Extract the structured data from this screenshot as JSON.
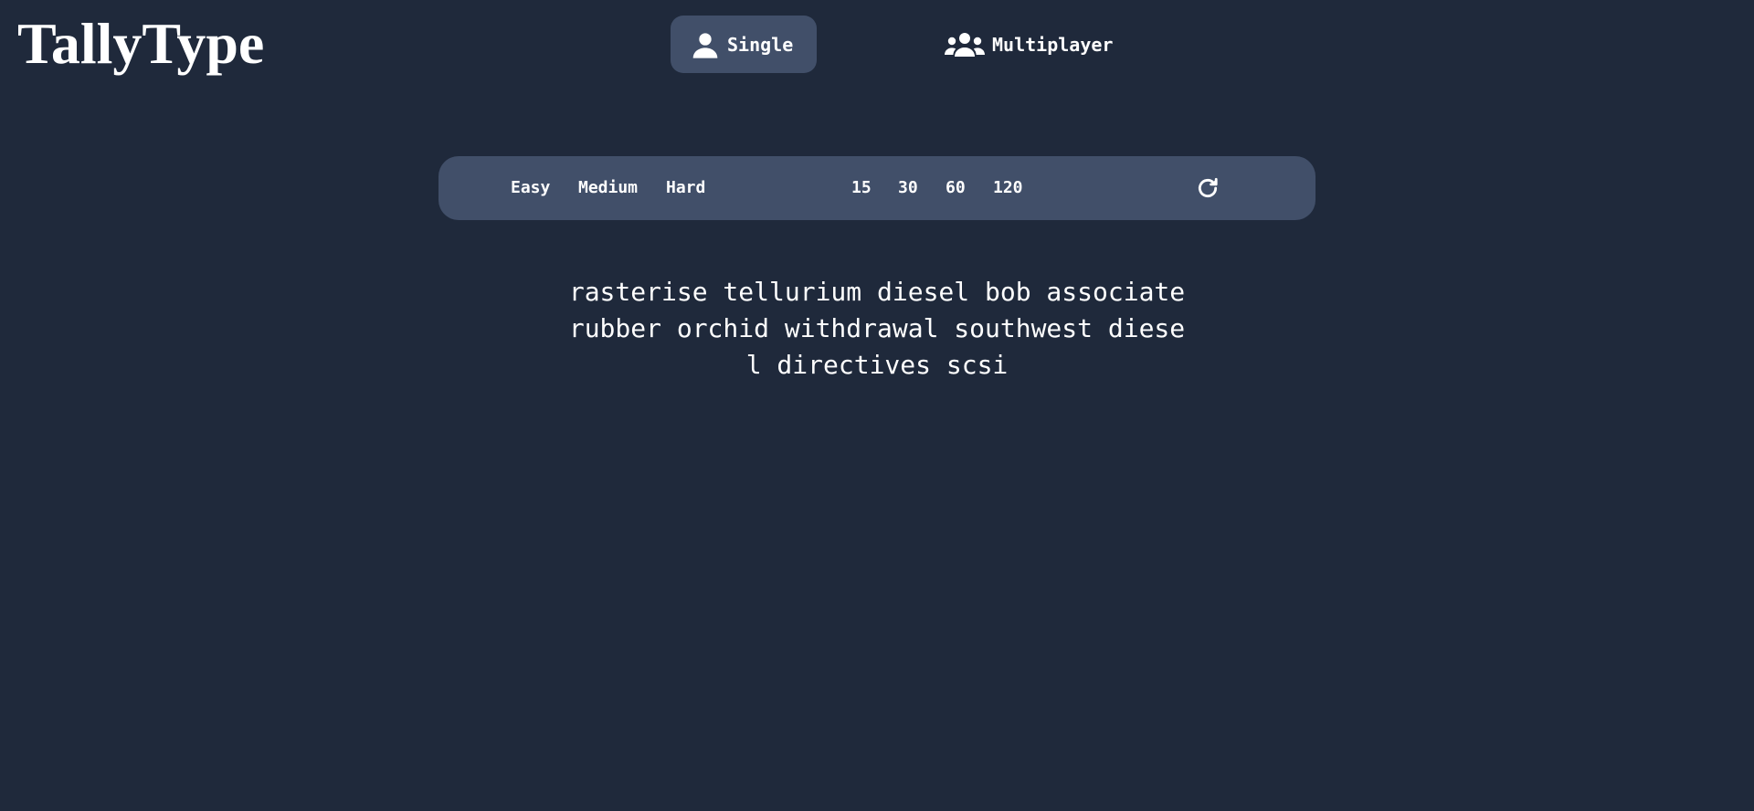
{
  "app": {
    "logo": "TallyType"
  },
  "modes": {
    "single": {
      "label": "Single",
      "icon": "user-icon",
      "active": true
    },
    "multiplayer": {
      "label": "Multiplayer",
      "icon": "users-icon",
      "active": false
    }
  },
  "toolbar": {
    "difficulty": [
      "Easy",
      "Medium",
      "Hard"
    ],
    "durations": [
      "15",
      "30",
      "60",
      "120"
    ],
    "restart_icon": "refresh-icon"
  },
  "words": {
    "lines": [
      "rasterise tellurium diesel bob associate",
      "rubber orchid withdrawal southwest diese",
      "l directives scsi"
    ]
  },
  "colors": {
    "background": "#1f293b",
    "panel": "#414f69",
    "text": "#ffffff"
  }
}
